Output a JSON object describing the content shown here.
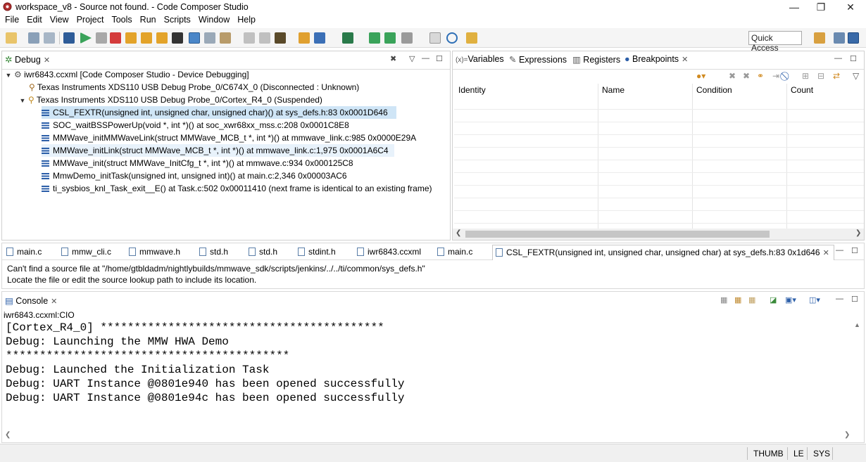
{
  "window": {
    "title": "workspace_v8 - Source not found. - Code Composer Studio",
    "minimize": "—",
    "restore": "❐",
    "close": "✕"
  },
  "menu": [
    "File",
    "Edit",
    "View",
    "Project",
    "Tools",
    "Run",
    "Scripts",
    "Window",
    "Help"
  ],
  "toolbar": {
    "quick_access": "Quick Access",
    "icons": [
      "new-icon",
      "save-icon",
      "save-all-icon",
      "terminal-icon",
      "resume-icon",
      "suspend-icon",
      "terminate-icon",
      "step-into-icon",
      "step-over-icon",
      "step-return-icon",
      "registers-icon",
      "connect-icon",
      "disconnect-icon",
      "build-icon",
      "debug-icon",
      "run-icon",
      "search-icon",
      "perspective-icon"
    ]
  },
  "debug_view": {
    "tab_label": "Debug",
    "tree": {
      "root": "iwr6843.ccxml [Code Composer Studio - Device Debugging]",
      "probe_disconnected": "Texas Instruments XDS110 USB Debug Probe_0/C674X_0 (Disconnected : Unknown)",
      "probe_suspended": "Texas Instruments XDS110 USB Debug Probe_0/Cortex_R4_0 (Suspended)",
      "frames": [
        "CSL_FEXTR(unsigned int, unsigned char, unsigned char)() at sys_defs.h:83 0x0001D646",
        "SOC_waitBSSPowerUp(void *, int *)() at soc_xwr68xx_mss.c:208 0x0001C8E8",
        "MMWave_initMMWaveLink(struct MMWave_MCB_t *, int *)() at mmwave_link.c:985 0x0000E29A",
        "MMWave_initLink(struct MMWave_MCB_t *, int *)() at mmwave_link.c:1,975 0x0001A6C4",
        "MMWave_init(struct MMWave_InitCfg_t *, int *)() at mmwave.c:934 0x000125C8",
        "MmwDemo_initTask(unsigned int, unsigned int)() at main.c:2,346 0x00003AC6",
        "ti_sysbios_knl_Task_exit__E() at Task.c:502 0x00011410  (next frame is identical to an existing frame)"
      ]
    }
  },
  "right_view": {
    "tabs": [
      "Variables",
      "Expressions",
      "Registers",
      "Breakpoints"
    ],
    "tab_prefix": "(x)=",
    "active_tab": "Breakpoints",
    "columns": [
      "Identity",
      "Name",
      "Condition",
      "Count"
    ]
  },
  "editor": {
    "tabs": [
      "main.c",
      "mmw_cli.c",
      "mmwave.h",
      "std.h",
      "std.h",
      "stdint.h",
      "iwr6843.ccxml",
      "main.c"
    ],
    "active_tab": "CSL_FEXTR(unsigned int, unsigned char, unsigned char) at sys_defs.h:83 0x1d646",
    "message_line1": "Can't find a source file at \"/home/gtbldadm/nightlybuilds/mmwave_sdk/scripts/jenkins/../../ti/common/sys_defs.h\"",
    "message_line2": "Locate the file or edit the source lookup path to include its location."
  },
  "console": {
    "tab_label": "Console",
    "subtitle": "iwr6843.ccxml:CIO",
    "lines": [
      "[Cortex_R4_0] ******************************************",
      "Debug: Launching the MMW HWA Demo",
      "******************************************",
      "Debug: Launched the Initialization Task",
      "Debug: UART Instance @0801e940 has been opened successfully",
      "Debug: UART Instance @0801e94c has been opened successfully"
    ]
  },
  "status": [
    "THUMB",
    "LE",
    "SYS"
  ],
  "colors": {
    "selection": "#cfe5f6",
    "accent": "#2b5ea8"
  }
}
